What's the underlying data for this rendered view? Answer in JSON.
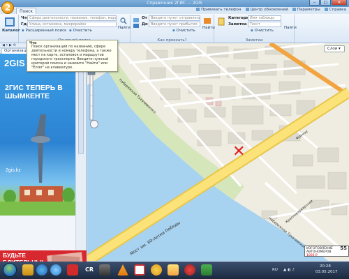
{
  "window": {
    "title": "Справочник 2ГИС — 2GIS"
  },
  "ribbon": {
    "tab_active": "Поиск",
    "top_links": [
      "Привязать телефон",
      "Центр обновлений",
      "Параметры",
      "Справка"
    ],
    "catalog_label": "Каталог",
    "what_label": "Что",
    "what_placeholder": "Сфера деятельности, название, телефон, маршрут",
    "where_label": "Где",
    "where_placeholder": "Улица, остановка, микрорайон",
    "advanced_search": "Расширенный поиск",
    "clear_1": "Очистить",
    "find_1": "Найти",
    "main_search_label": "Основной поиск",
    "from_label": "От",
    "from_placeholder": "Введите пункт отправления",
    "to_label": "До",
    "to_placeholder": "Введите пункт прибытия",
    "clear_2": "Очистить",
    "find_2": "Найти",
    "how_to_get": "Как проехать?",
    "category_label": "Категория",
    "category_placeholder": "Имя таблицы",
    "note_label": "Заметка",
    "note_placeholder": "Текст",
    "clear_3": "Очистить",
    "find_3": "Найти",
    "notes_group_label": "Заметки"
  },
  "left_panel": {
    "nav_text": "◀ • ▶ ⟲",
    "tab_label": "Организации",
    "ad_logo": "2GIS",
    "ad_title": "2ГИС ТЕПЕРЬ В ШЫМКЕНТЕ",
    "ad_url": "2gis.kz",
    "ad2_text": "БУДЬТЕ БДИТЕЛЬНЫ!"
  },
  "tooltip": {
    "heading": "Что",
    "text": "Поиск организаций по названию, сфере деятельности и номеру телефона, а также мест на карте, остановок и маршрутов городского транспорта. Введите нужный критерий поиска и нажмите \"Найти\" или \"Enter\" на клавиатуре."
  },
  "map": {
    "layers_button": "Слои",
    "labels": {
      "bridge": "Мост им. 60-летия Победы",
      "street_embankment_1": "Набережная Тухачевского",
      "street_krasnovarskaya": "Красноварварская",
      "street_embankment_2": "Набережная Тухачевского",
      "street_frunze": "Фрунзе"
    },
    "scale_text": "ИЗГОТОВЛЕНИЕ АВТОНОМЕРОВ",
    "scale_price": "1000 ₽",
    "scale_value": "55",
    "marker": "✕"
  },
  "taskbar": {
    "cr_label": "CR",
    "lang": "RU",
    "time": "20:28",
    "date": "03.05.2017"
  },
  "colors": {
    "water": "#a8d3f0",
    "road_main": "#fbe37a",
    "road_edge": "#e8c64a",
    "building": "#dddad0",
    "land": "#efece2",
    "marker": "#e02020"
  }
}
